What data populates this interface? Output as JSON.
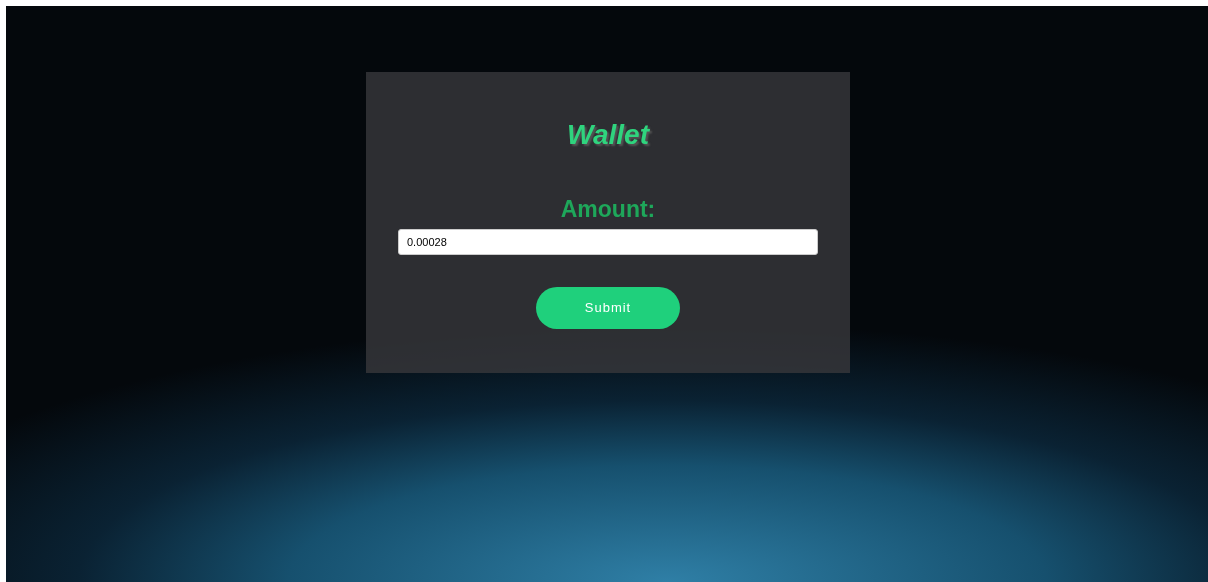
{
  "title": "Wallet",
  "amount": {
    "label": "Amount:",
    "value": "0.00028"
  },
  "submit": {
    "label": "Submit"
  }
}
